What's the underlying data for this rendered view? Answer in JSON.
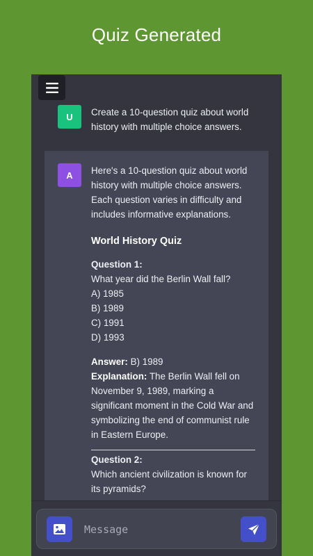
{
  "header": {
    "title": "Quiz Generated"
  },
  "user_message": {
    "avatar_letter": "U",
    "text": "Create a 10-question quiz about world history with multiple choice answers."
  },
  "assistant_message": {
    "avatar_letter": "A",
    "intro": "Here's a 10-question quiz about world history with multiple choice answers. Each question varies in difficulty and includes informative explanations.",
    "quiz_title": "World History Quiz",
    "questions": [
      {
        "label": "Question 1:",
        "text": "What year did the Berlin Wall fall?",
        "options": [
          "A) 1985",
          "B) 1989",
          "C) 1991",
          "D) 1993"
        ],
        "answer_label": "Answer:",
        "answer": " B) 1989",
        "explanation_label": "Explanation:",
        "explanation": " The Berlin Wall fell on November 9, 1989, marking a significant moment in the Cold War and symbolizing the end of communist rule in Eastern Europe."
      },
      {
        "label": "Question 2:",
        "text": "Which ancient civilization is known for its pyramids?"
      }
    ]
  },
  "composer": {
    "placeholder": "Message"
  },
  "colors": {
    "background": "#5e9631",
    "panel": "#34353f",
    "assistant_block": "#444655",
    "user_avatar": "#19c37d",
    "assistant_avatar": "#8e4fe3",
    "accent_button": "#4450c9"
  },
  "icons": {
    "menu": "hamburger-icon",
    "image": "image-icon",
    "send": "send-icon"
  }
}
